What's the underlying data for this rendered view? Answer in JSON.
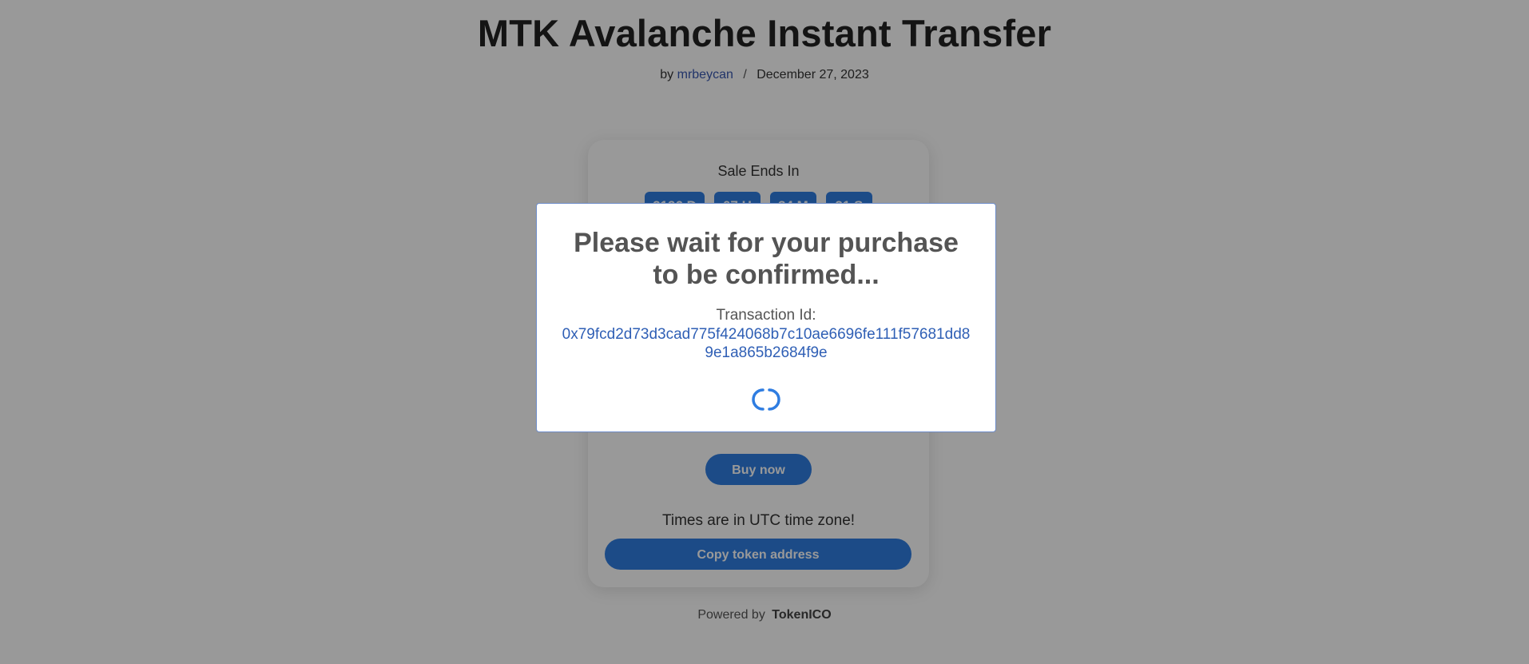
{
  "post": {
    "title": "MTK Avalanche Instant Transfer",
    "by_prefix": "by",
    "author": "mrbeycan",
    "separator": "/",
    "date": "December 27, 2023"
  },
  "card": {
    "sale_ends_label": "Sale Ends In",
    "countdown": [
      "2196 D",
      "07 H",
      "34 M",
      "21 S"
    ],
    "buy_button": "Buy now",
    "utc_note": "Times are in UTC time zone!",
    "copy_button": "Copy token address"
  },
  "footer": {
    "powered_by": "Powered by",
    "brand": "TokenICO"
  },
  "modal": {
    "title": "Please wait for your purchase to be confirmed...",
    "tx_label": "Transaction Id:",
    "tx_id": "0x79fcd2d73d3cad775f424068b7c10ae6696fe111f57681dd89e1a865b2684f9e"
  },
  "colors": {
    "accent": "#2f7de1",
    "link": "#2f5fb5",
    "overlay": "rgba(0,0,0,0.4)"
  }
}
